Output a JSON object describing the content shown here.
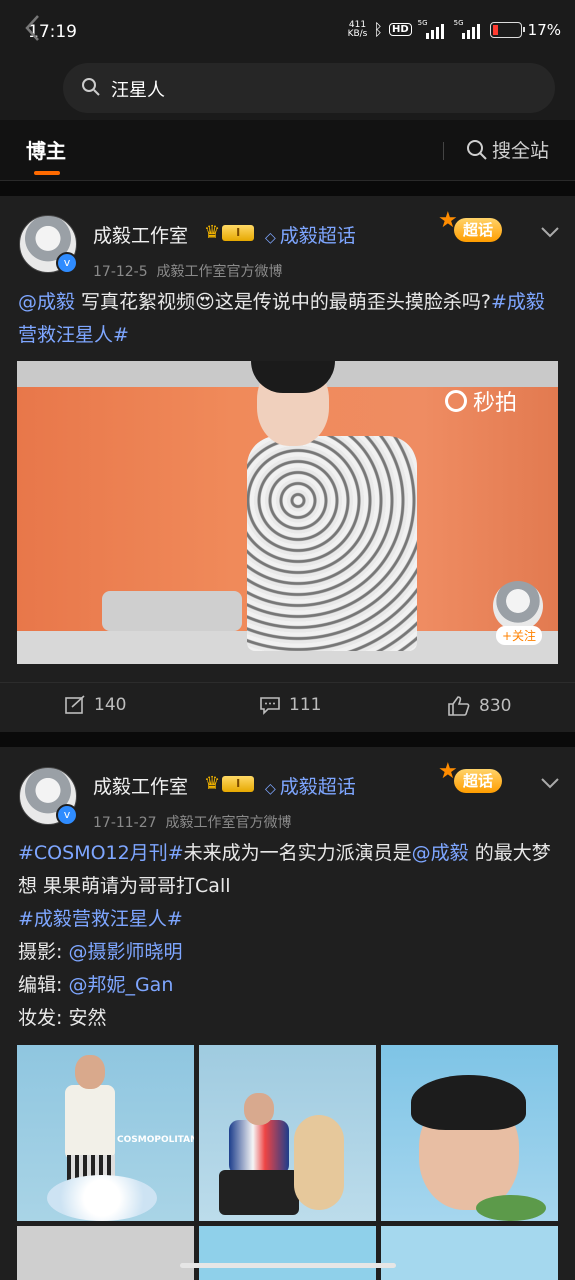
{
  "status_bar": {
    "time": "17:19",
    "net_speed_top": "411",
    "net_speed_bottom": "KB/s",
    "hd_label": "HD",
    "sim1": "5G",
    "sim2": "5G",
    "battery": "17%"
  },
  "search": {
    "query": "汪星人"
  },
  "tabs": {
    "active": "博主",
    "search_all": "搜全站"
  },
  "posts": [
    {
      "author": "成毅工作室",
      "level": "I",
      "topic": "成毅超话",
      "chaohua_badge": "超话",
      "date": "17-12-5",
      "source": "成毅工作室官方微博",
      "text": {
        "mention": "@成毅",
        "content": " 写真花絮视频😍这是传说中的最萌歪头摸脸杀吗?",
        "hashtag": "#成毅营救汪星人#"
      },
      "video": {
        "watermark": "秒拍",
        "follow_label": "+关注"
      },
      "actions": {
        "reposts": "140",
        "comments": "111",
        "likes": "830"
      }
    },
    {
      "author": "成毅工作室",
      "level": "I",
      "topic": "成毅超话",
      "chaohua_badge": "超话",
      "date": "17-11-27",
      "source": "成毅工作室官方微博",
      "text": {
        "hashtag1": "#COSMO12月刊#",
        "part1": "未来成为一名实力派演员是",
        "mention": "@成毅",
        "part2": " 的最大梦想 果果萌请为哥哥打Call",
        "hashtag2": "#成毅营救汪星人#",
        "photo_label": "摄影: ",
        "photographer": "@摄影师晓明",
        "editor_label": "编辑: ",
        "editor": "@邦妮_Gan",
        "makeup_label": "妆发: ",
        "makeup": "安然"
      },
      "photo_caption": "COSMOPOLITAN"
    }
  ]
}
